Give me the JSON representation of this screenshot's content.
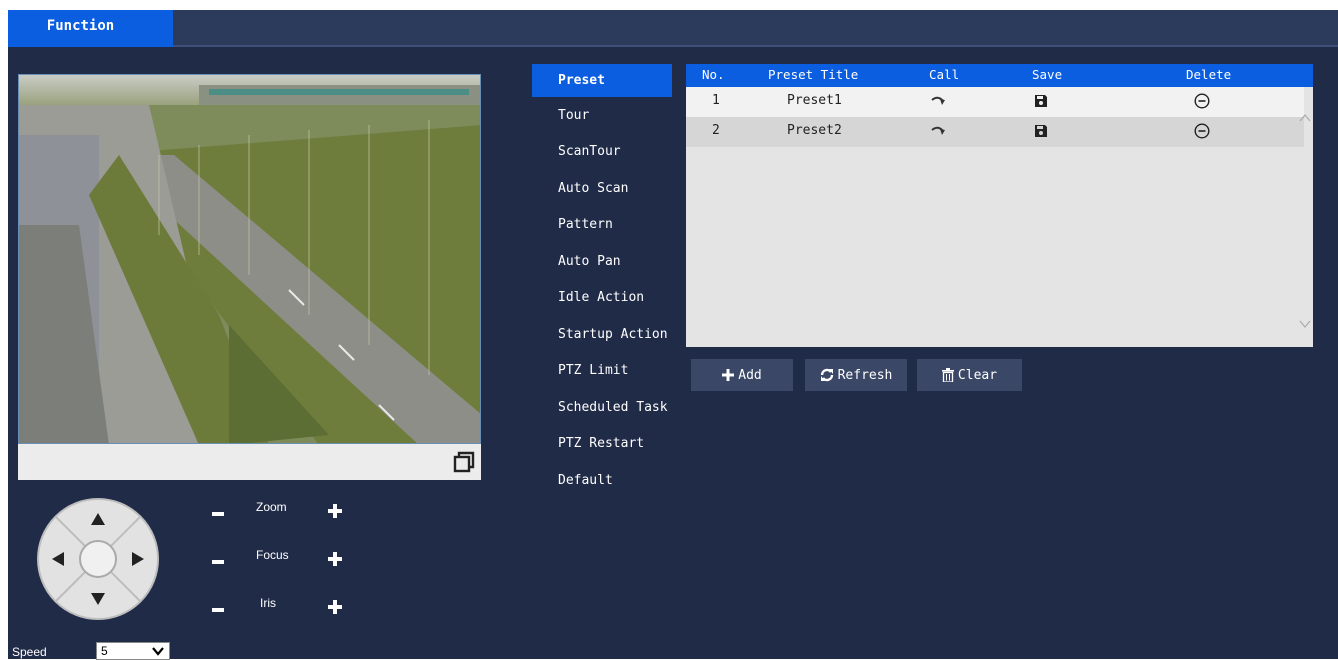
{
  "header": {
    "tab_label": "Function"
  },
  "ptz": {
    "zoom_label": "Zoom",
    "focus_label": "Focus",
    "iris_label": "Iris",
    "speed_label": "Speed",
    "speed_value": "5"
  },
  "menu": {
    "items": [
      {
        "label": "Preset",
        "active": true
      },
      {
        "label": "Tour"
      },
      {
        "label": "ScanTour"
      },
      {
        "label": "Auto Scan"
      },
      {
        "label": "Pattern"
      },
      {
        "label": "Auto Pan"
      },
      {
        "label": "Idle Action"
      },
      {
        "label": "Startup Action"
      },
      {
        "label": "PTZ Limit"
      },
      {
        "label": "Scheduled Task"
      },
      {
        "label": "PTZ Restart"
      },
      {
        "label": "Default"
      }
    ]
  },
  "table": {
    "columns": [
      "No.",
      "Preset Title",
      "Call",
      "Save",
      "Delete"
    ],
    "rows": [
      {
        "no": "1",
        "title": "Preset1"
      },
      {
        "no": "2",
        "title": "Preset2"
      }
    ]
  },
  "actions": {
    "add_label": "Add",
    "refresh_label": "Refresh",
    "clear_label": "Clear"
  },
  "colors": {
    "accent": "#0b5ee0",
    "background": "#202b48",
    "button": "#3a4766"
  }
}
